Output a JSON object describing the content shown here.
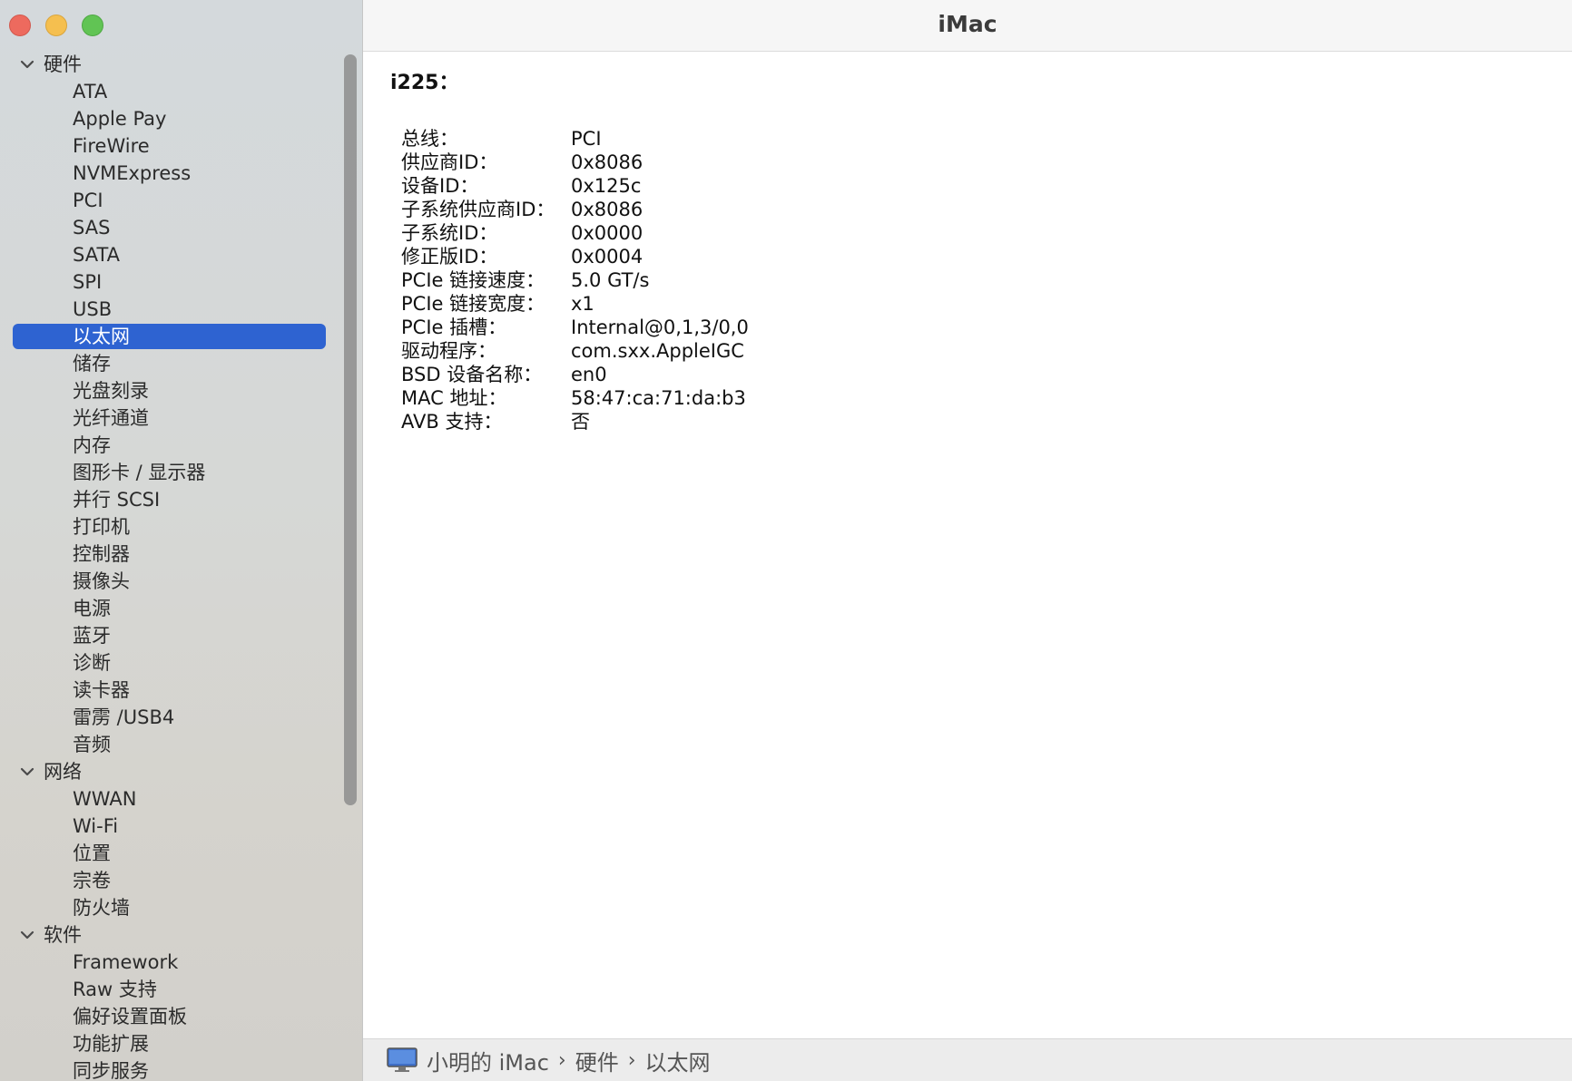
{
  "window": {
    "title": "iMac"
  },
  "sidebar": {
    "groups": [
      {
        "label": "硬件",
        "items": [
          "ATA",
          "Apple Pay",
          "FireWire",
          "NVMExpress",
          "PCI",
          "SAS",
          "SATA",
          "SPI",
          "USB",
          "以太网",
          "储存",
          "光盘刻录",
          "光纤通道",
          "内存",
          "图形卡 / 显示器",
          "并行 SCSI",
          "打印机",
          "控制器",
          "摄像头",
          "电源",
          "蓝牙",
          "诊断",
          "读卡器",
          "雷雳 /USB4",
          "音频"
        ]
      },
      {
        "label": "网络",
        "items": [
          "WWAN",
          "Wi-Fi",
          "位置",
          "宗卷",
          "防火墙"
        ]
      },
      {
        "label": "软件",
        "items": [
          "Framework",
          "Raw 支持",
          "偏好设置面板",
          "功能扩展",
          "同步服务"
        ]
      }
    ],
    "selected": "以太网"
  },
  "detail": {
    "heading": "i225：",
    "properties": [
      {
        "key": "总线：",
        "value": "PCI"
      },
      {
        "key": "供应商ID：",
        "value": "0x8086"
      },
      {
        "key": "设备ID：",
        "value": "0x125c"
      },
      {
        "key": "子系统供应商ID：",
        "value": "0x8086"
      },
      {
        "key": "子系统ID：",
        "value": "0x0000"
      },
      {
        "key": "修正版ID：",
        "value": "0x0004"
      },
      {
        "key": "PCIe 链接速度：",
        "value": "5.0 GT/s"
      },
      {
        "key": "PCIe 链接宽度：",
        "value": "x1"
      },
      {
        "key": "PCIe 插槽：",
        "value": "Internal@0,1,3/0,0"
      },
      {
        "key": "驱动程序：",
        "value": "com.sxx.AppleIGC"
      },
      {
        "key": "BSD 设备名称：",
        "value": "en0"
      },
      {
        "key": "MAC 地址：",
        "value": "58:47:ca:71:da:b3"
      },
      {
        "key": "AVB 支持：",
        "value": "否"
      }
    ]
  },
  "statusbar": {
    "icon": "imac-icon",
    "path": [
      "小明的 iMac",
      "硬件",
      "以太网"
    ]
  },
  "colors": {
    "selection": "#2e63d1",
    "close": "#ed6a5e",
    "minimize": "#f5bf4f",
    "maximize": "#61c454"
  }
}
